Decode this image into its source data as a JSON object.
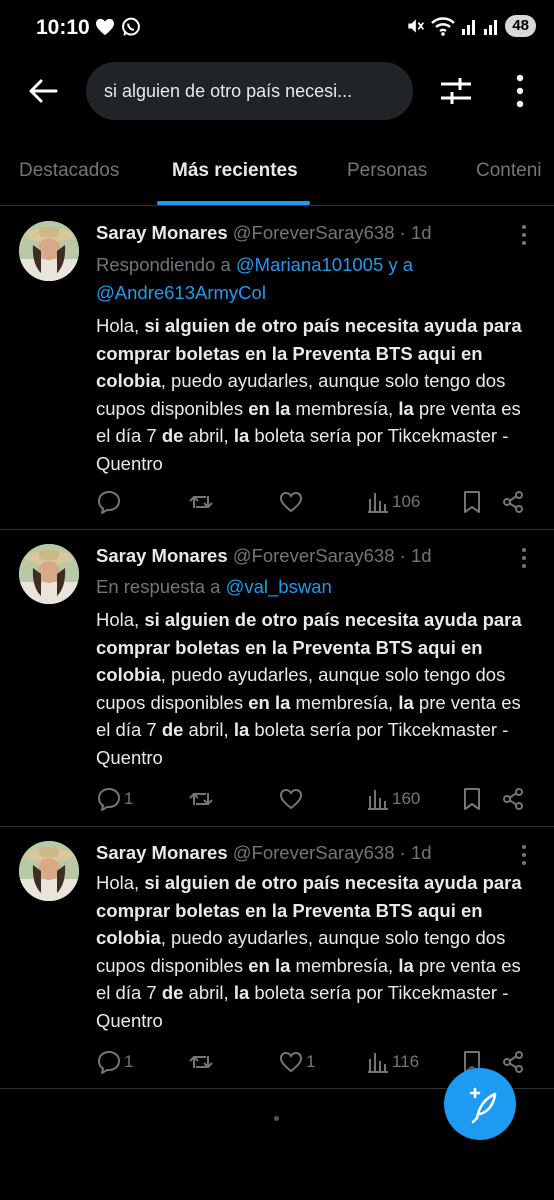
{
  "status_bar": {
    "time": "10:10",
    "battery": "48"
  },
  "search": {
    "query": "si alguien de otro país necesi..."
  },
  "tabs": [
    {
      "label": "Destacados"
    },
    {
      "label": "Más recientes"
    },
    {
      "label": "Personas"
    },
    {
      "label": "Conteni"
    }
  ],
  "tweets": [
    {
      "name": "Saray Monares",
      "handle": "@ForeverSaray638",
      "sep": " · ",
      "time": "1d",
      "reply_prefix": "Respondiendo a ",
      "reply_mention_1": "@Mariana101005 y a",
      "reply_mention_2": "@Andre613ArmyCol",
      "replies": "",
      "likes": "",
      "views": "106"
    },
    {
      "name": "Saray Monares",
      "handle": "@ForeverSaray638",
      "sep": " · ",
      "time": "1d",
      "reply_prefix": "En respuesta a ",
      "reply_mention_1": "@val_bswan",
      "replies": "1",
      "likes": "",
      "views": "160"
    },
    {
      "name": "Saray Monares",
      "handle": "@ForeverSaray638",
      "sep": " · ",
      "time": "1d",
      "replies": "1",
      "likes": "1",
      "views": "116"
    }
  ],
  "tweet_text": {
    "t1": "Hola, ",
    "b1": "si alguien de otro país necesita ayuda para comprar boletas en la Preventa BTS aqui en colobia",
    "t2": ", puedo ayudarles, aunque solo tengo dos cupos disponibles ",
    "b2": "en la",
    "t3": " membresía, ",
    "b3": "la",
    "t4": " pre venta es el día 7 ",
    "b4": "de",
    "t5": " abril, ",
    "b5": "la",
    "t6": " boleta sería por Tikcekmaster - Quentro"
  },
  "colors": {
    "accent": "#1d9bf0",
    "muted": "#71767b",
    "text": "#e7e9ea",
    "background": "#000000"
  },
  "icons": [
    "back-arrow-icon",
    "filter-sliders-icon",
    "more-vertical-icon",
    "reply-icon",
    "retweet-icon",
    "like-icon",
    "views-icon",
    "bookmark-icon",
    "share-icon",
    "compose-icon"
  ]
}
